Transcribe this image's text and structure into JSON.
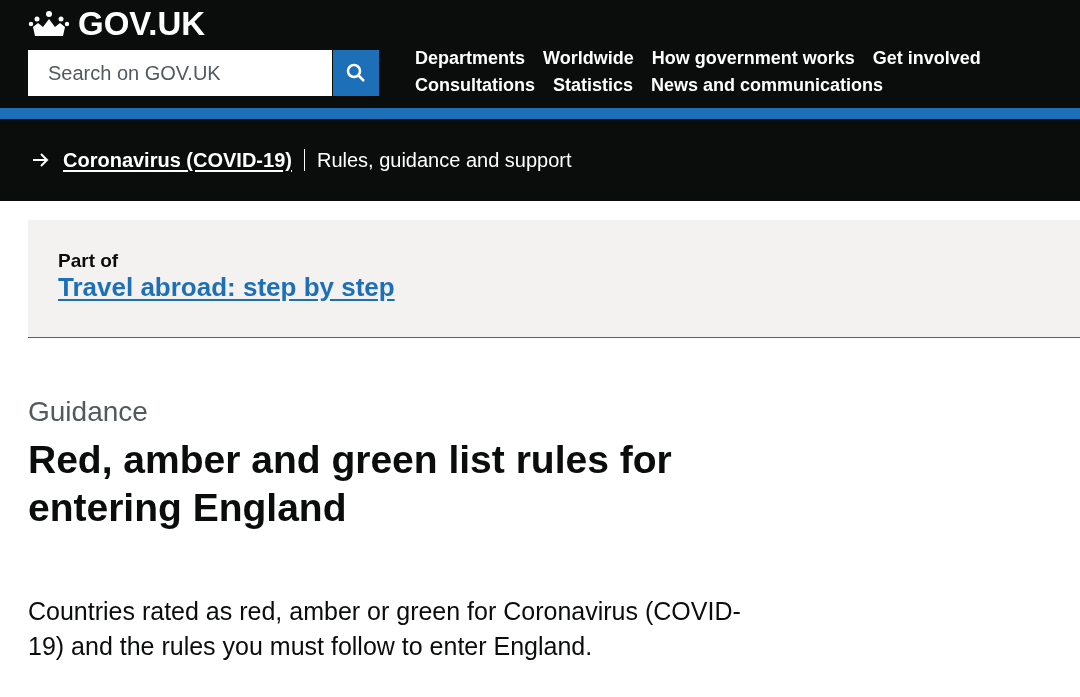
{
  "header": {
    "logo": "GOV.UK",
    "search": {
      "placeholder": "Search on GOV.UK"
    },
    "nav": [
      [
        "Departments",
        "Worldwide",
        "How government works",
        "Get involved"
      ],
      [
        "Consultations",
        "Statistics",
        "News and communications"
      ]
    ]
  },
  "breadcrumb": {
    "link": "Coronavirus (COVID-19)",
    "current": "Rules, guidance and support"
  },
  "part_of": {
    "label": "Part of",
    "link": "Travel abroad: step by step"
  },
  "page": {
    "type": "Guidance",
    "title": "Red, amber and green list rules for entering England",
    "description": "Countries rated as red, amber or green for Coronavirus (COVID-19) and the rules you must follow to enter England."
  }
}
